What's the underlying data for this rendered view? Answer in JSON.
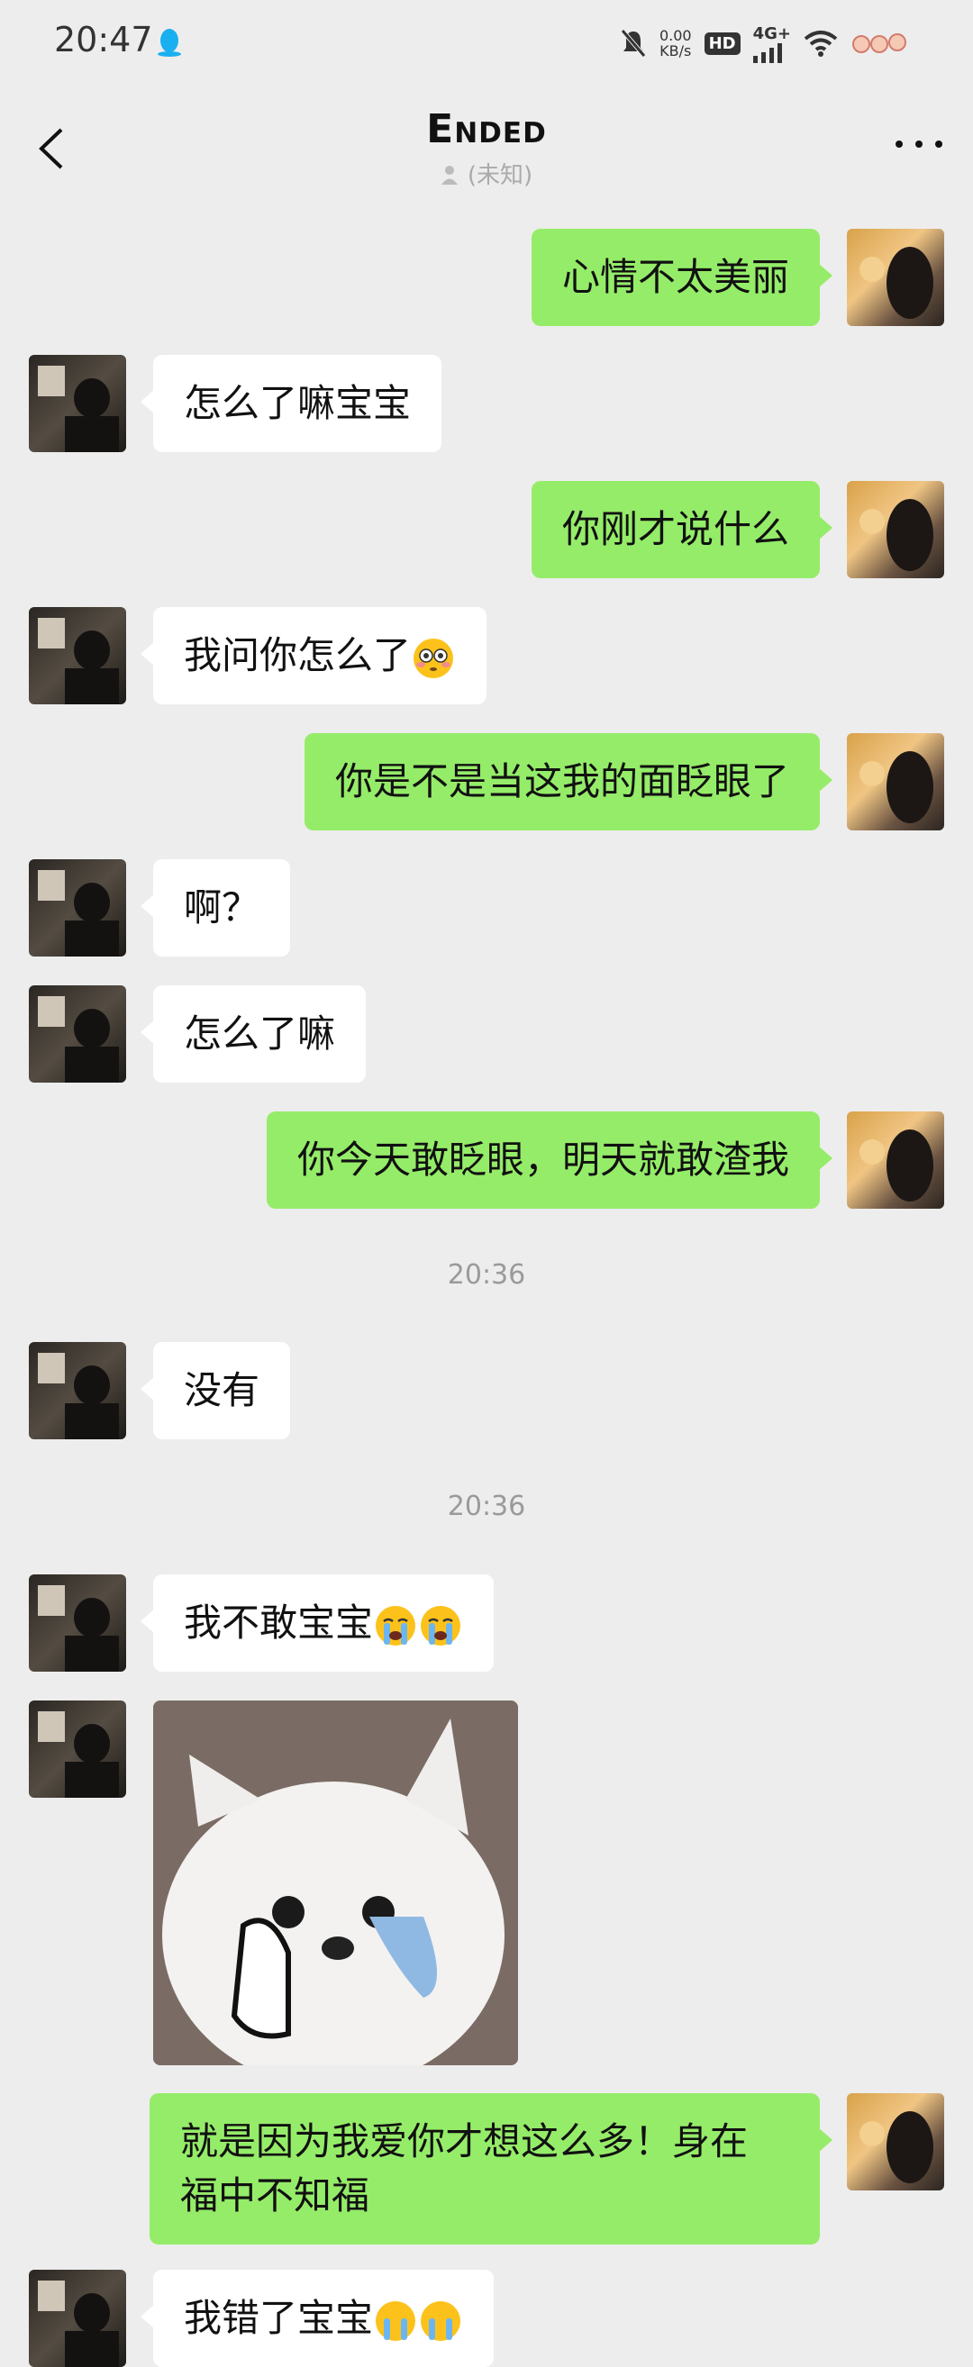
{
  "status_bar": {
    "time": "20:47",
    "net_speed_value": "0.00",
    "net_speed_unit": "KB/s",
    "hd": "HD",
    "network": "4G+"
  },
  "nav": {
    "title": "Ended",
    "subtitle": "(未知)"
  },
  "messages": [
    {
      "side": "right",
      "text": "心情不太美丽"
    },
    {
      "side": "left",
      "text": "怎么了嘛宝宝"
    },
    {
      "side": "right",
      "text": "你刚才说什么"
    },
    {
      "side": "left",
      "text": "我问你怎么了",
      "emoji": "flushed-face"
    },
    {
      "side": "right",
      "text": "你是不是当这我的面眨眼了"
    },
    {
      "side": "left",
      "text": "啊？"
    },
    {
      "side": "left",
      "text": "怎么了嘛"
    },
    {
      "side": "right",
      "text": "你今天敢眨眼，明天就敢渣我"
    },
    {
      "type": "time",
      "text": "20:36"
    },
    {
      "side": "left",
      "text": "没有"
    },
    {
      "type": "time",
      "text": "20:36"
    },
    {
      "side": "left",
      "text": "我不敢宝宝",
      "emoji": "loudly-crying-face x2"
    },
    {
      "side": "left",
      "type": "sticker",
      "sticker": "crying-white-dog-sticker"
    },
    {
      "side": "right",
      "text": "就是因为我爱你才想这么多！身在\n福中不知福"
    },
    {
      "side": "left",
      "text": "我错了宝宝",
      "emoji": "loudly-crying-face x2"
    }
  ],
  "colors": {
    "background": "#ededed",
    "sent_bubble": "#95ec69",
    "received_bubble": "#ffffff"
  }
}
